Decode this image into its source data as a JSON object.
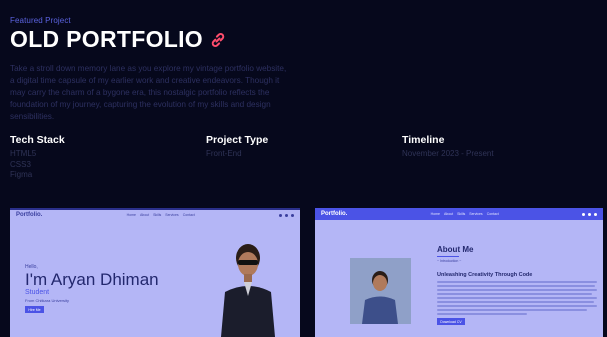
{
  "header": {
    "eyebrow": "Featured Project",
    "title": "OLD PORTFOLIO",
    "link_icon": "link-icon"
  },
  "description": "Take a stroll down memory lane as you explore my vintage portfolio website, a digital time capsule of my earlier work and creative endeavors. Though it may carry the charm of a bygone era, this nostalgic portfolio reflects the foundation of my journey, capturing the evolution of my skills and design sensibilities.",
  "meta": {
    "tech_stack": {
      "label": "Tech Stack",
      "items": [
        "HTML5",
        "CSS3",
        "Figma"
      ]
    },
    "project_type": {
      "label": "Project Type",
      "value": "Front-End"
    },
    "timeline": {
      "label": "Timeline",
      "value": "November 2023 - Present"
    }
  },
  "screenshot_home": {
    "brand": "Portfolio.",
    "nav": [
      "Home",
      "About",
      "Skills",
      "Services",
      "Contact"
    ],
    "hello": "Hello,",
    "name": "I'm Aryan Dhiman",
    "role": "Student",
    "university": "From Chitkara University",
    "hire_button": "Hire Me"
  },
  "screenshot_about": {
    "brand": "Portfolio.",
    "nav": [
      "Home",
      "About",
      "Skills",
      "Services",
      "Contact"
    ],
    "title": "About Me",
    "subtitle": "~ Introduction ~",
    "heading": "Unleashing Creativity Through Code",
    "cv_button": "Download CV"
  },
  "colors": {
    "background": "#06081c",
    "accent": "#4b53e6",
    "preview_bg": "#b4b6f6"
  }
}
